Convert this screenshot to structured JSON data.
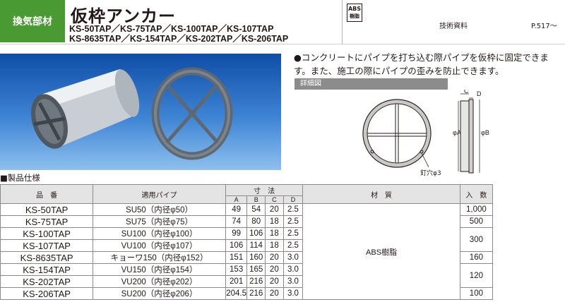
{
  "header": {
    "category": "換気部材",
    "title": "仮枠アンカー",
    "models_line1": "KS-50TAP／KS-75TAP／KS-100TAP／KS-107TAP",
    "models_line2": "KS-8635TAP／KS-154TAP／KS-202TAP／KS-206TAP",
    "material_badge_top": "ABS",
    "material_badge_bottom": "樹脂",
    "tech_label": "技術資料",
    "tech_page": "P.517～"
  },
  "description": {
    "text": "●コンクリートにパイプを打ち込む際パイプを仮枠に固定できます。また、施工の際にパイプの歪みを防止できます。"
  },
  "detail": {
    "tab_label": "詳細図",
    "label_c": "C",
    "label_d": "D",
    "label_a": "φA",
    "label_b": "φB",
    "nail_hole": "釘穴φ3"
  },
  "specs": {
    "heading": "■製品仕様",
    "headers": {
      "product": "品　番",
      "pipe": "適用パイプ",
      "dimensions": "寸　法",
      "material": "材　質",
      "quantity": "入　数",
      "a": "A",
      "b": "B",
      "c": "C",
      "d": "D"
    },
    "material_value": "ABS樹脂",
    "rows": [
      {
        "code": "KS-50TAP",
        "pipe": "SU50（内径φ50）",
        "a": "49",
        "b": "54",
        "c": "20",
        "d": "2.5",
        "qty": "1,000"
      },
      {
        "code": "KS-75TAP",
        "pipe": "SU75（内径φ75）",
        "a": "74",
        "b": "80",
        "c": "18",
        "d": "2.5",
        "qty": "500"
      },
      {
        "code": "KS-100TAP",
        "pipe": "SU100（内径φ100）",
        "a": "99",
        "b": "106",
        "c": "18",
        "d": "2.5",
        "qty": "300"
      },
      {
        "code": "KS-107TAP",
        "pipe": "VU100（内径φ107）",
        "a": "106",
        "b": "114",
        "c": "18",
        "d": "2.5",
        "qty": ""
      },
      {
        "code": "KS-8635TAP",
        "pipe": "キョーワ150（内径φ152）",
        "a": "151",
        "b": "160",
        "c": "20",
        "d": "3.0",
        "qty": "160"
      },
      {
        "code": "KS-154TAP",
        "pipe": "VU150（内径φ154）",
        "a": "153",
        "b": "165",
        "c": "20",
        "d": "3.0",
        "qty": "120"
      },
      {
        "code": "KS-202TAP",
        "pipe": "VU200（内径φ202）",
        "a": "201",
        "b": "216",
        "c": "20",
        "d": "3.0",
        "qty": ""
      },
      {
        "code": "KS-206TAP",
        "pipe": "SU200（内径φ206）",
        "a": "204.5",
        "b": "216",
        "c": "20",
        "d": "3.0",
        "qty": "100"
      }
    ]
  }
}
